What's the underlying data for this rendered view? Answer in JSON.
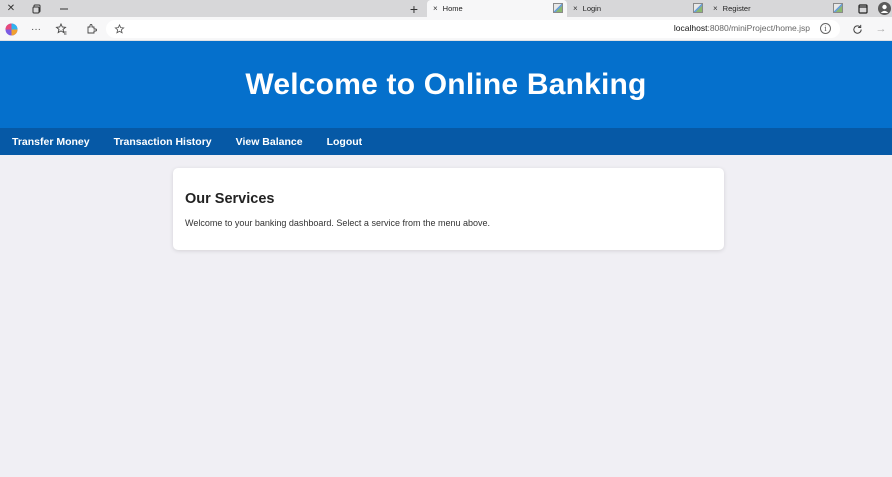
{
  "browser": {
    "tabs": [
      {
        "label": "Home",
        "close": "×",
        "active": true
      },
      {
        "label": "Login",
        "close": "×",
        "active": false
      },
      {
        "label": "Register",
        "close": "×",
        "active": false
      }
    ],
    "new_tab": "+",
    "url_host": "localhost",
    "url_path": ":8080/miniProject/home.jsp",
    "icons": {
      "window_close": "close-icon",
      "restore": "restore-icon",
      "minimize": "minimize-icon",
      "favorites": "favorites-icon",
      "refresh": "refresh-icon",
      "forward": "forward-icon",
      "info": "info-icon"
    }
  },
  "page": {
    "heading": "Welcome to Online Banking",
    "nav": [
      "Transfer Money",
      "Transaction History",
      "View Balance",
      "Logout"
    ],
    "card": {
      "title": "Our Services",
      "text": "Welcome to your banking dashboard. Select a service from the menu above."
    },
    "colors": {
      "header": "#0570cc",
      "nav": "#0659a6",
      "background": "#f0eff4"
    }
  }
}
